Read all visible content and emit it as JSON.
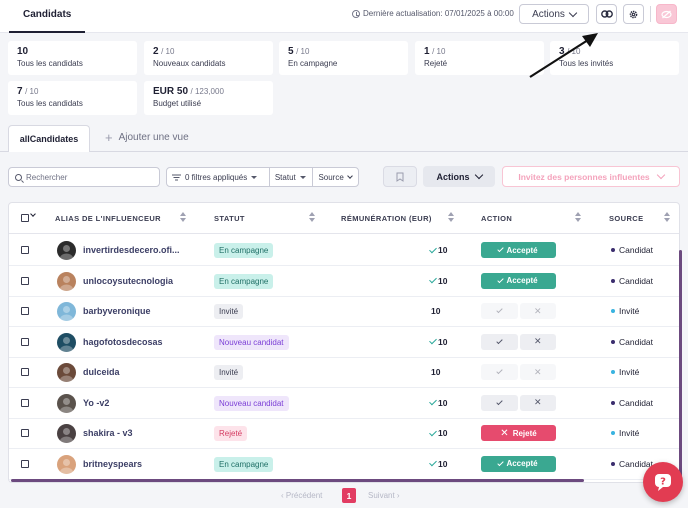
{
  "header": {
    "tab": "Candidats",
    "last_update": "Dernière actualisation: 07/01/2025 à 00:00",
    "actions_label": "Actions",
    "icons": [
      "link-icon",
      "gear-icon",
      "hide-icon"
    ]
  },
  "stats": [
    {
      "value": "10",
      "denom": "",
      "label": "Tous les candidats"
    },
    {
      "value": "2",
      "denom": "/ 10",
      "label": "Nouveaux candidats"
    },
    {
      "value": "5",
      "denom": "/ 10",
      "label": "En campagne"
    },
    {
      "value": "1",
      "denom": "/ 10",
      "label": "Rejeté"
    },
    {
      "value": "3",
      "denom": "/ 10",
      "label": "Tous les invités"
    },
    {
      "value": "7",
      "denom": "/ 10",
      "label": "Tous les candidats"
    },
    {
      "value": "EUR 50",
      "denom": "/ 123,000",
      "label": "Budget utilisé"
    }
  ],
  "views": {
    "active": "allCandidates",
    "add": "Ajouter une vue"
  },
  "toolbar": {
    "search_placeholder": "Rechercher",
    "filters_applied": "0 filtres appliqués",
    "status_filter": "Statut",
    "source_filter": "Source",
    "actions": "Actions",
    "invite": "Invitez des personnes influentes"
  },
  "table": {
    "columns": {
      "alias": "ALIAS DE L'INFLUENCEUR",
      "status": "STATUT",
      "pay": "RÉMUNÉRATION (EUR)",
      "action": "ACTION",
      "source": "SOURCE"
    },
    "action_labels": {
      "accepted": "Accepté",
      "rejected": "Rejeté"
    },
    "rows": [
      {
        "alias": "invertirdesdecero.ofi...",
        "status": "En campagne",
        "status_kind": "campagne",
        "pay": "10",
        "paid_check": true,
        "action": "accepted",
        "source": "Candidat",
        "source_color": "#3b2d6e",
        "avatar_color": "#2b2b2b"
      },
      {
        "alias": "unlocoysutecnologia",
        "status": "En campagne",
        "status_kind": "campagne",
        "pay": "10",
        "paid_check": true,
        "action": "accepted",
        "source": "Candidat",
        "source_color": "#3b2d6e",
        "avatar_color": "#b9825e"
      },
      {
        "alias": "barbyveronique",
        "status": "Invité",
        "status_kind": "invite",
        "pay": "10",
        "paid_check": false,
        "action": "pending_disabled",
        "source": "Invité",
        "source_color": "#39b3e0",
        "avatar_color": "#7fb7d9"
      },
      {
        "alias": "hagofotosdecosas",
        "status": "Nouveau candidat",
        "status_kind": "nouveau",
        "pay": "10",
        "paid_check": true,
        "action": "pending",
        "source": "Candidat",
        "source_color": "#3b2d6e",
        "avatar_color": "#1e4d63"
      },
      {
        "alias": "dulceida",
        "status": "Invité",
        "status_kind": "invite",
        "pay": "10",
        "paid_check": false,
        "action": "pending_disabled",
        "source": "Invité",
        "source_color": "#39b3e0",
        "avatar_color": "#6b4a3a"
      },
      {
        "alias": "Yo -v2",
        "status": "Nouveau candidat",
        "status_kind": "nouveau",
        "pay": "10",
        "paid_check": true,
        "action": "pending",
        "source": "Candidat",
        "source_color": "#3b2d6e",
        "avatar_color": "#5a524c"
      },
      {
        "alias": "shakira - v3",
        "status": "Rejeté",
        "status_kind": "rejete",
        "pay": "10",
        "paid_check": true,
        "action": "rejected",
        "source": "Invité",
        "source_color": "#39b3e0",
        "avatar_color": "#4a4142"
      },
      {
        "alias": "britneyspears",
        "status": "En campagne",
        "status_kind": "campagne",
        "pay": "10",
        "paid_check": true,
        "action": "accepted",
        "source": "Candidat",
        "source_color": "#3b2d6e",
        "avatar_color": "#d9a27c"
      }
    ]
  },
  "pagination": {
    "prev": "Précédent",
    "current": "1",
    "next": "Suivant"
  },
  "colors": {
    "brand": "#e23c62",
    "accepted": "#3aa891",
    "rejected": "#e64b6e"
  }
}
